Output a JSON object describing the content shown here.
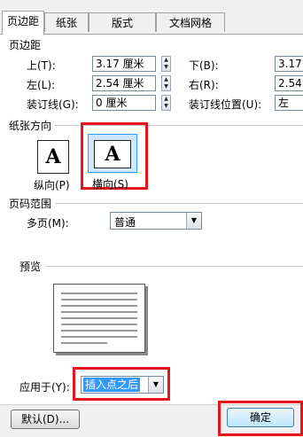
{
  "tabs": [
    {
      "label": "页边距",
      "active": true
    },
    {
      "label": "纸张",
      "active": false
    },
    {
      "label": "版式",
      "active": false
    },
    {
      "label": "文档网格",
      "active": false
    }
  ],
  "margins": {
    "section_title": "页边距",
    "top_label": "上(T):",
    "top_value": "3.17 厘米",
    "bottom_label": "下(B):",
    "bottom_value": "3.17",
    "left_label": "左(L):",
    "left_value": "2.54 厘米",
    "right_label": "右(R):",
    "right_value": "2.54",
    "gutter_label": "装订线(G):",
    "gutter_value": "0 厘米",
    "gutter_pos_label": "装订线位置(U):",
    "gutter_pos_value": "左"
  },
  "orientation": {
    "section_title": "纸张方向",
    "portrait_label": "纵向(P)",
    "landscape_label": "横向(S)",
    "glyph": "A",
    "selected": "landscape"
  },
  "pages": {
    "section_title": "页码范围",
    "multiple_label": "多页(M):",
    "multiple_value": "普通"
  },
  "preview": {
    "section_title": "预览"
  },
  "apply": {
    "label": "应用于(Y):",
    "value": "插入点之后"
  },
  "buttons": {
    "default_label": "默认(D)...",
    "ok_label": "确定"
  },
  "colors": {
    "highlight_frame": "#e8141b",
    "selection": "#3399ff"
  }
}
